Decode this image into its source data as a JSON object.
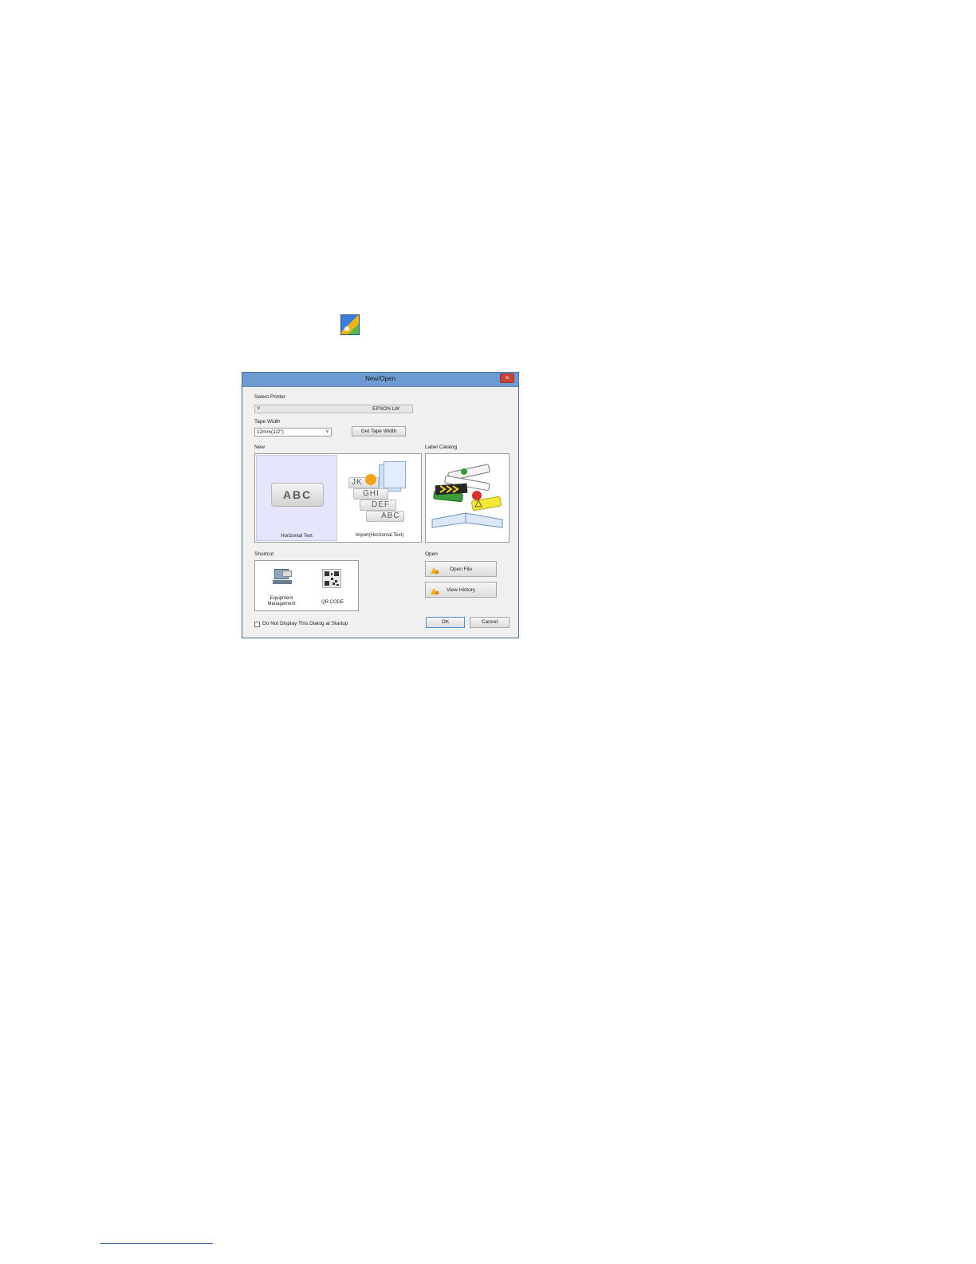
{
  "dialog": {
    "title": "New/Open",
    "close_symbol": "×",
    "select_printer_label": "Select Printer",
    "printer_value": "EPSON LW",
    "tape_width_label": "Tape Width",
    "tape_width_value": "12mm(1/2\")",
    "get_tape_width_label": "Get Tape Width",
    "new_label": "New",
    "label_catalog_label": "Label Catalog",
    "new_items": [
      {
        "caption": "Horizontal Text",
        "icon": "abc-label-icon",
        "selected": true
      },
      {
        "caption": "Import(Horizontal Text)",
        "icon": "import-labels-icon",
        "selected": false
      }
    ],
    "import_tile_text": [
      "JK",
      "GHI",
      "DEF",
      "ABC"
    ],
    "abc_text": "ABC",
    "shortcut_label": "Shortcut",
    "shortcuts": [
      {
        "caption_line1": "Equipment",
        "caption_line2": "Management",
        "icon": "equipment-management-icon"
      },
      {
        "caption_line1": "QR CODE",
        "caption_line2": "",
        "icon": "qr-code-icon"
      }
    ],
    "open_label": "Open",
    "open_file_label": "Open File",
    "view_history_label": "View History",
    "do_not_display_label": "Do Not Display This Dialog at Startup",
    "do_not_display_checked": false,
    "ok_label": "OK",
    "cancel_label": "Cancel"
  },
  "colors": {
    "titlebar": "#6f9bd3",
    "close_button": "#c9453a",
    "selected_tile": "#e5e6fb",
    "app_icon_blue": "#3f7ed8",
    "app_icon_orange": "#f2b21c",
    "app_icon_green": "#5cb84a"
  }
}
